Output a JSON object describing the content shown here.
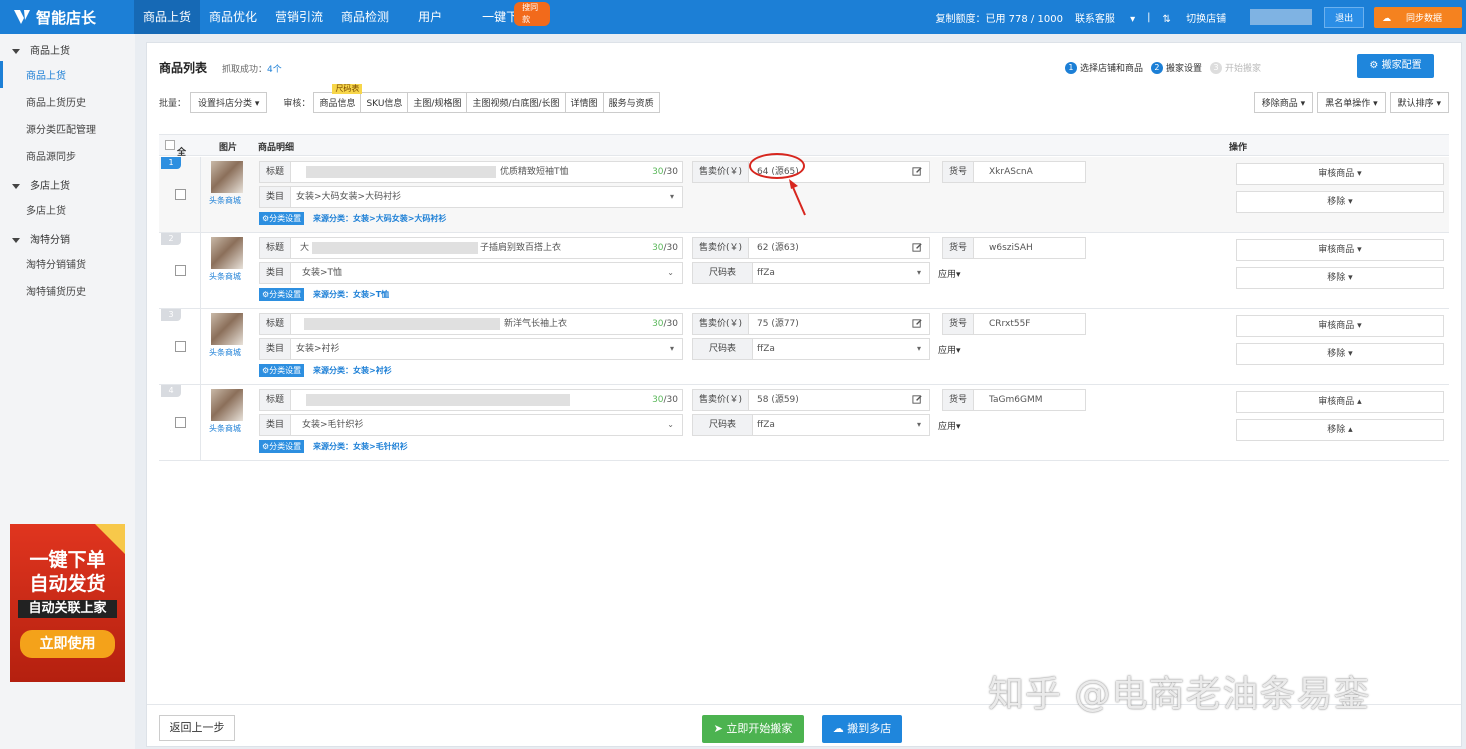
{
  "app": {
    "name": "智能店长"
  },
  "nav": [
    "商品上货",
    "商品优化",
    "营销引流",
    "商品检测",
    "用户",
    "一键下单"
  ],
  "nav_badge": "搜同款",
  "topright": {
    "quota": "复制额度：已用 778 / 1000",
    "service": "联系客服",
    "switch": "切换店铺",
    "logout": "退出",
    "sync": "同步数据"
  },
  "sidebar": {
    "groups": [
      {
        "label": "商品上货",
        "items": [
          "商品上货",
          "商品上货历史",
          "源分类匹配管理",
          "商品源同步"
        ]
      },
      {
        "label": "多店上货",
        "items": [
          "多店上货"
        ]
      },
      {
        "label": "淘特分销",
        "items": [
          "淘特分销铺货",
          "淘特铺货历史"
        ]
      }
    ]
  },
  "ad": {
    "l1": "一键下单",
    "l2": "自动发货",
    "l3": "自动关联上家",
    "btn": "立即使用"
  },
  "panel": {
    "title": "商品列表",
    "sub_prefix": "抓取成功：",
    "sub_count": "4个",
    "steps": [
      "选择店铺和商品",
      "搬家设置",
      "开始搬家"
    ],
    "config_btn": "搬家配置"
  },
  "toolbar": {
    "batch_label": "批量：",
    "batch_select": "设置抖店分类",
    "audit_label": "审核：",
    "tabs": [
      "商品信息",
      "SKU信息",
      "主图/规格图",
      "主图视频/白底图/长图",
      "详情图",
      "服务与资质"
    ],
    "tab_badge": "尺码表",
    "right": [
      "移除商品",
      "黑名单操作",
      "默认排序"
    ]
  },
  "thead": {
    "all": "全选",
    "img": "图片",
    "desc": "商品明细",
    "op": "操作"
  },
  "labels": {
    "title": "标题",
    "cat": "类目",
    "price": "售卖价(￥)",
    "sku": "货号",
    "size": "尺码表",
    "apply": "应用",
    "cat_btn": "分类设置",
    "audit": "审核商品",
    "remove": "移除",
    "shop": "头条商城"
  },
  "rows": [
    {
      "num": "1",
      "title_tail": "优质精致短袖T恤",
      "title_count": "30",
      "title_max": "/30",
      "category": "女装>大码女装>大码衬衫",
      "source": "来源分类：女装>大码女装>大码衬衫",
      "price": "64 (源65)",
      "sku": "XkrAScnA"
    },
    {
      "num": "2",
      "title_head": "大",
      "title_tail": "子插肩别致百搭上衣",
      "title_count": "30",
      "title_max": "/30",
      "category": "女装>T恤",
      "source": "来源分类：女装>T恤",
      "price": "62 (源63)",
      "sku": "w6sziSAH",
      "size": "ffZa"
    },
    {
      "num": "3",
      "title_tail": "新洋气长袖上衣",
      "title_count": "30",
      "title_max": "/30",
      "category": "女装>衬衫",
      "source": "来源分类：女装>衬衫",
      "price": "75 (源77)",
      "sku": "CRrxt55F",
      "size": "ffZa"
    },
    {
      "num": "4",
      "title_count": "30",
      "title_max": "/30",
      "category": "女装>毛针织衫",
      "source": "来源分类：女装>毛针织衫",
      "price": "58 (源59)",
      "sku": "TaGm6GMM",
      "size": "ffZa"
    }
  ],
  "footer": {
    "back": "返回上一步",
    "start": "立即开始搬家",
    "multi": "搬到多店"
  },
  "watermark": "知乎 @电商老油条易銮"
}
